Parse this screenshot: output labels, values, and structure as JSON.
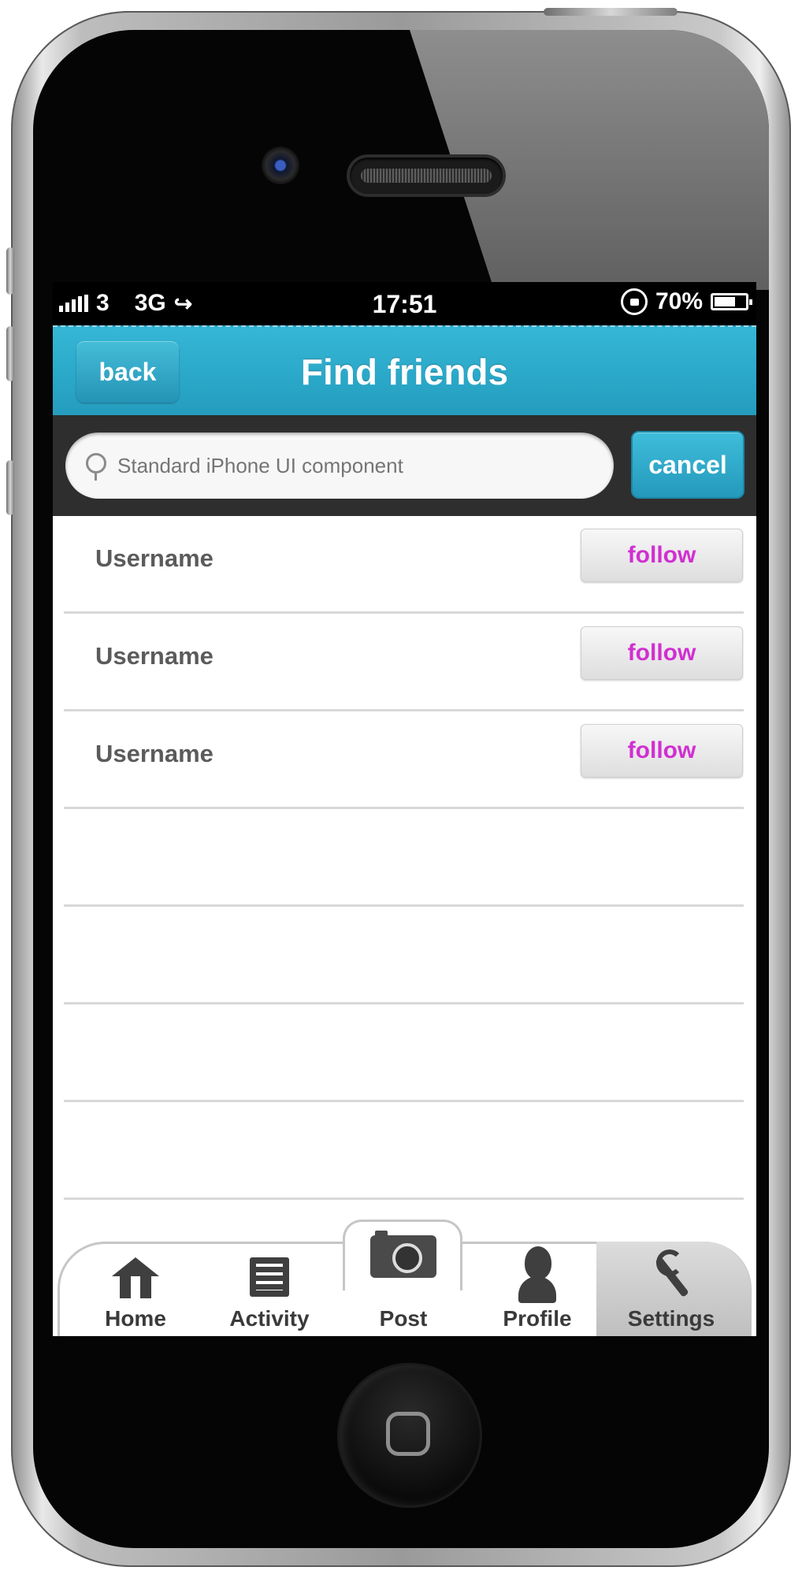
{
  "status": {
    "carrier": "3",
    "network": "3G",
    "time": "17:51",
    "battery": "70%"
  },
  "nav": {
    "back_label": "back",
    "title": "Find friends"
  },
  "search": {
    "placeholder": "Standard iPhone UI component",
    "cancel_label": "cancel"
  },
  "results": [
    {
      "name": "Username",
      "action": "follow"
    },
    {
      "name": "Username",
      "action": "follow"
    },
    {
      "name": "Username",
      "action": "follow"
    }
  ],
  "tabs": [
    {
      "label": "Home",
      "icon": "home-icon"
    },
    {
      "label": "Activity",
      "icon": "list-icon"
    },
    {
      "label": "Post",
      "icon": "camera-icon"
    },
    {
      "label": "Profile",
      "icon": "profile-icon"
    },
    {
      "label": "Settings",
      "icon": "wrench-icon"
    }
  ],
  "colors": {
    "accent": "#2ba9ca",
    "follow_text": "#d12fd1",
    "search_bg": "#2e2e2e"
  }
}
